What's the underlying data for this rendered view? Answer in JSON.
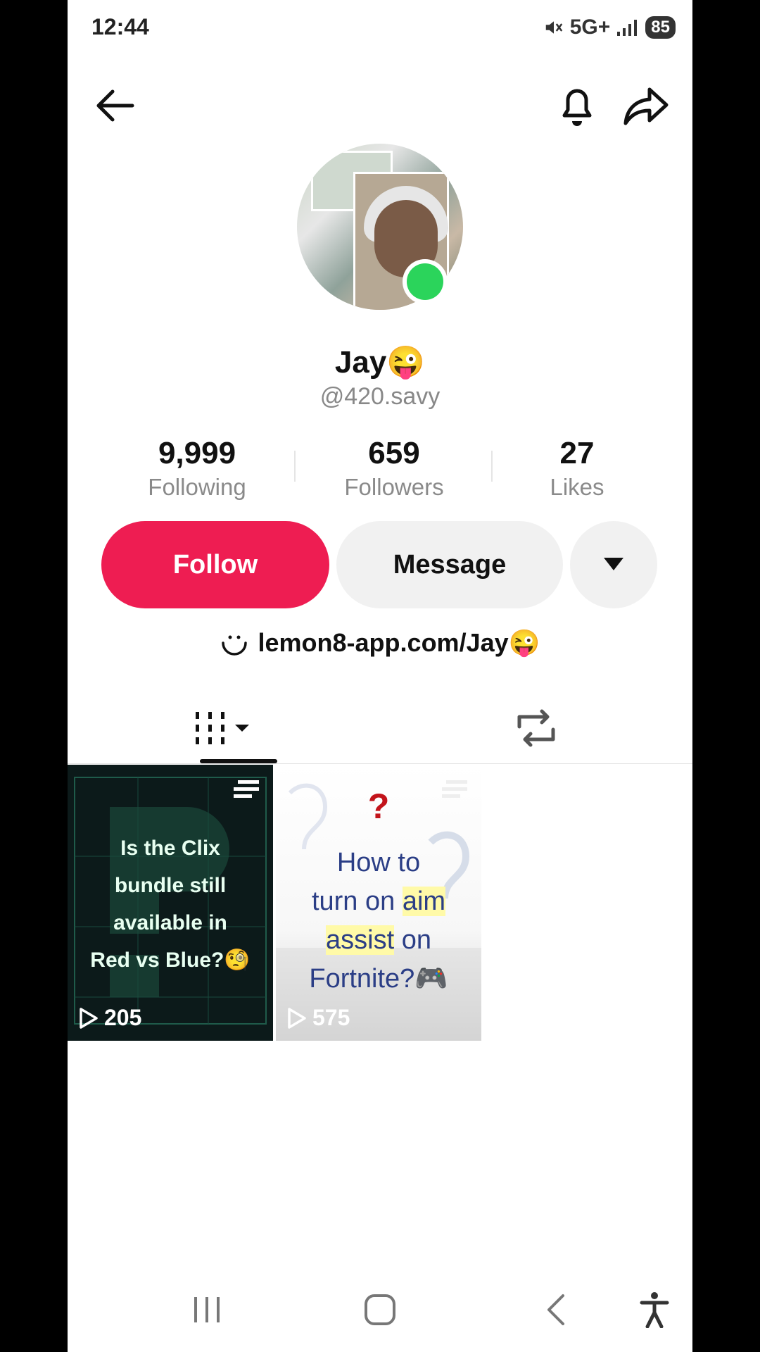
{
  "status_bar": {
    "time": "12:44",
    "network": "5G+",
    "battery": "85"
  },
  "profile": {
    "name": "Jay😜",
    "handle": "@420.savy",
    "stats": [
      {
        "value": "9,999",
        "label": "Following"
      },
      {
        "value": "659",
        "label": "Followers"
      },
      {
        "value": "27",
        "label": "Likes"
      }
    ],
    "follow_label": "Follow",
    "message_label": "Message",
    "bio_link": "lemon8-app.com/Jay😜"
  },
  "colors": {
    "follow_bg": "#ee1d52",
    "online": "#2bd45b"
  },
  "videos": [
    {
      "caption_lines": [
        "Is the Clix",
        "bundle still",
        "available in",
        "Red vs Blue?🧐"
      ],
      "views": "205"
    },
    {
      "mark": "?",
      "caption_lines": [
        "How to",
        "turn on aim",
        "assist on",
        "Fortnite?🎮"
      ],
      "views": "575"
    }
  ],
  "icons": {
    "back": "back-arrow-icon",
    "bell": "bell-icon",
    "share": "share-icon",
    "tab_videos": "grid-icon",
    "tab_reposts": "repost-icon"
  }
}
